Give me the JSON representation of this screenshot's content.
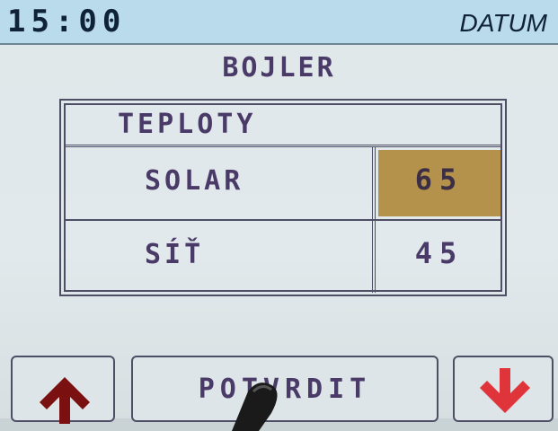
{
  "header": {
    "time": "15:00",
    "datum_label": "DATUM"
  },
  "page": {
    "title": "BOJLER"
  },
  "table": {
    "heading": "TEPLOTY",
    "rows": [
      {
        "label": "SOLAR",
        "value": "65",
        "selected": true
      },
      {
        "label": "SÍŤ",
        "value": "45",
        "selected": false
      }
    ]
  },
  "buttons": {
    "up_icon": "arrow-up-icon",
    "confirm_label": "POTVRDIT",
    "down_icon": "arrow-down-icon"
  },
  "colors": {
    "topbar": "#b9dbeb",
    "selected_cell": "#b4924b",
    "text": "#4a3a67",
    "arrow_up": "#7a1010",
    "arrow_down": "#e0343b"
  }
}
